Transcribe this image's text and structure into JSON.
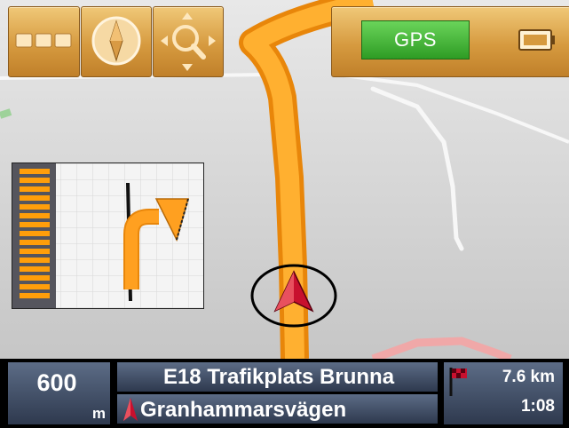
{
  "toolbar": {
    "gps_label": "GPS"
  },
  "maneuver": {
    "distance_value": "600",
    "distance_unit": "m"
  },
  "route": {
    "next_road": "E18 Trafikplats Brunna",
    "current_road": "Granhammarsvägen"
  },
  "trip": {
    "remaining_distance": "7.6 km",
    "remaining_time": "1:08"
  },
  "colors": {
    "route": "#ff9e0a",
    "button": "#d69a3f",
    "info_panel": "#3b4760",
    "gps_ok": "#3aaa2e",
    "position_marker": "#c8102e"
  }
}
